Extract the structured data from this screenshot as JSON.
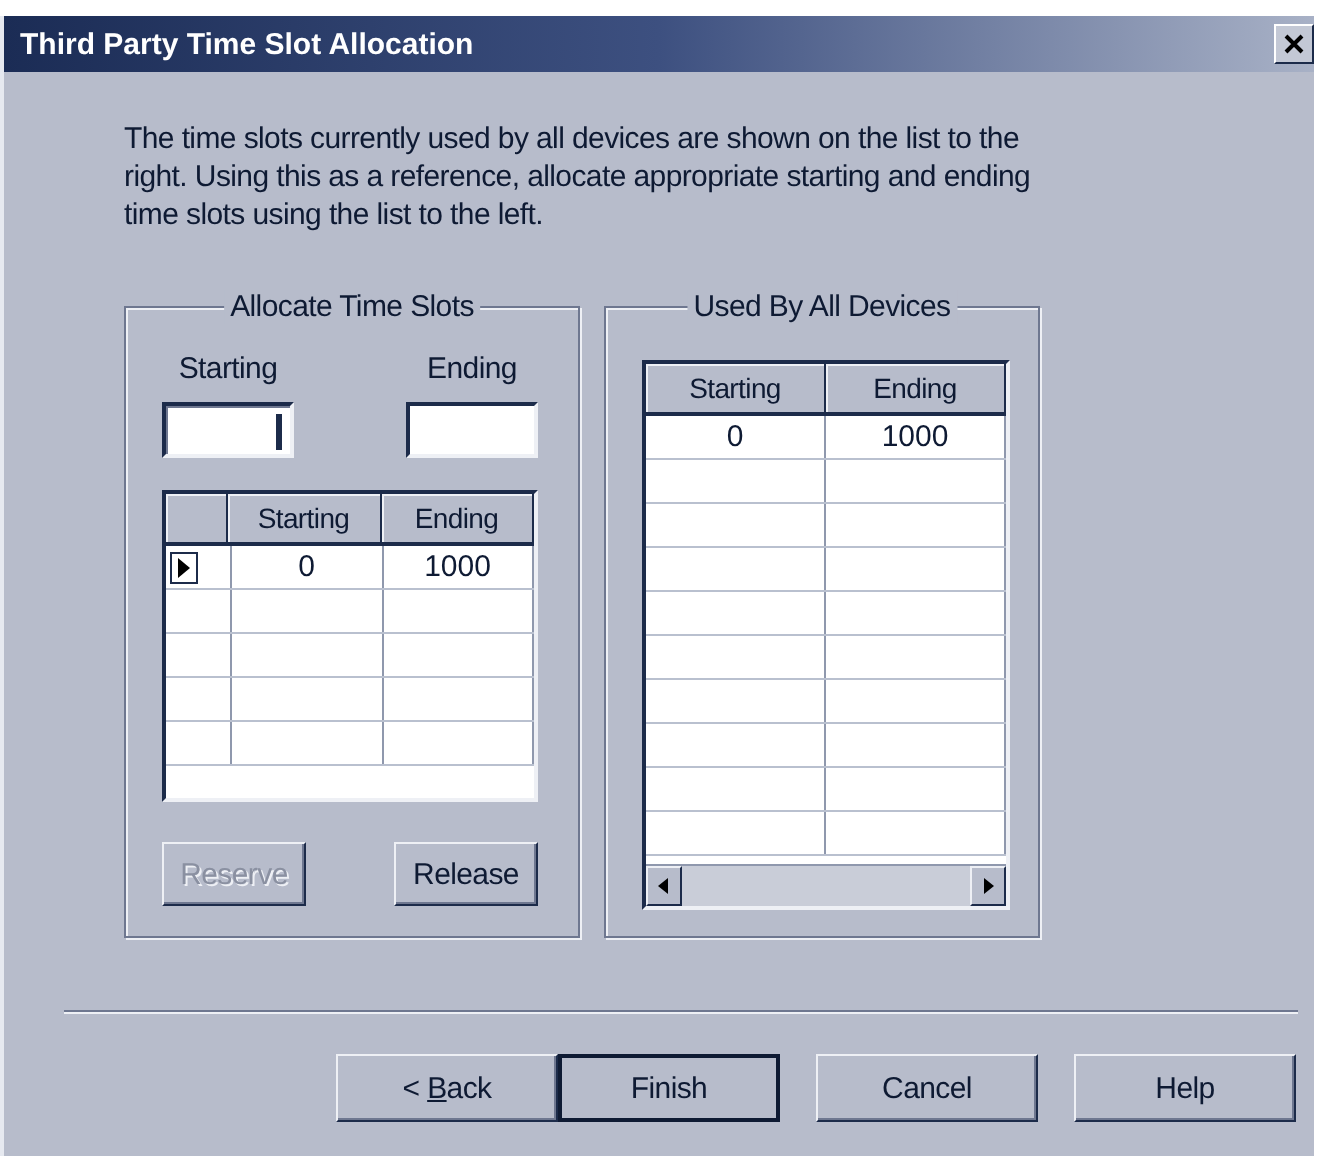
{
  "window": {
    "title": "Third Party Time Slot Allocation"
  },
  "intro": "The time slots currently used by all devices are shown on the list to the right. Using this as a reference, allocate appropriate starting and ending time slots using the list to the left.",
  "allocate": {
    "title": "Allocate Time Slots",
    "fields": [
      {
        "label": "Starting",
        "focused": true
      },
      {
        "label": "Ending",
        "focused": false
      }
    ],
    "columns": [
      "Starting",
      "Ending"
    ],
    "rows": [
      {
        "cells": [
          "0",
          "1000"
        ],
        "current": true
      }
    ],
    "buttons": [
      {
        "label": "Reserve",
        "disabled": true
      },
      {
        "label": "Release",
        "disabled": false
      }
    ]
  },
  "used": {
    "title": "Used By All Devices",
    "columns": [
      "Starting",
      "Ending"
    ],
    "rows": [
      {
        "cells": [
          "0",
          "1000"
        ]
      }
    ]
  },
  "buttons": [
    {
      "label": "< ",
      "mnemonic": "B",
      "label_rest": "ack",
      "default": false
    },
    {
      "label": "Finish",
      "default": true
    },
    {
      "label": "Cancel",
      "default": false
    },
    {
      "label": "Help",
      "default": false
    }
  ]
}
